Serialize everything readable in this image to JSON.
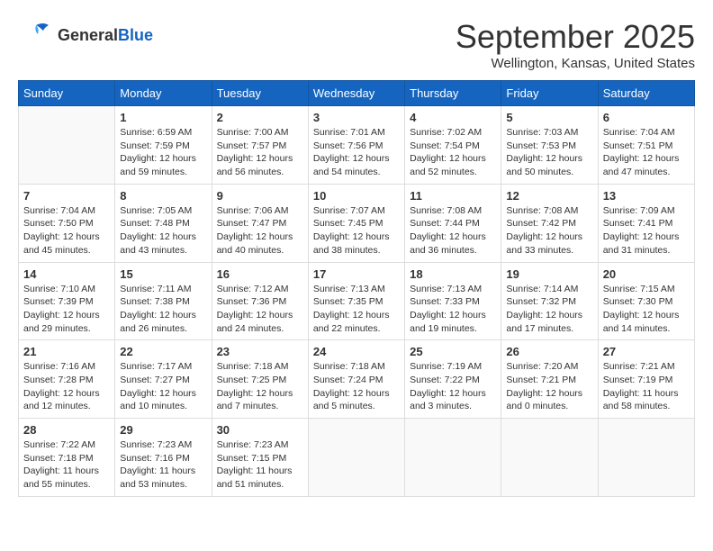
{
  "header": {
    "logo_general": "General",
    "logo_blue": "Blue",
    "month": "September 2025",
    "location": "Wellington, Kansas, United States"
  },
  "days_of_week": [
    "Sunday",
    "Monday",
    "Tuesday",
    "Wednesday",
    "Thursday",
    "Friday",
    "Saturday"
  ],
  "weeks": [
    [
      {
        "day": "",
        "info": ""
      },
      {
        "day": "1",
        "info": "Sunrise: 6:59 AM\nSunset: 7:59 PM\nDaylight: 12 hours\nand 59 minutes."
      },
      {
        "day": "2",
        "info": "Sunrise: 7:00 AM\nSunset: 7:57 PM\nDaylight: 12 hours\nand 56 minutes."
      },
      {
        "day": "3",
        "info": "Sunrise: 7:01 AM\nSunset: 7:56 PM\nDaylight: 12 hours\nand 54 minutes."
      },
      {
        "day": "4",
        "info": "Sunrise: 7:02 AM\nSunset: 7:54 PM\nDaylight: 12 hours\nand 52 minutes."
      },
      {
        "day": "5",
        "info": "Sunrise: 7:03 AM\nSunset: 7:53 PM\nDaylight: 12 hours\nand 50 minutes."
      },
      {
        "day": "6",
        "info": "Sunrise: 7:04 AM\nSunset: 7:51 PM\nDaylight: 12 hours\nand 47 minutes."
      }
    ],
    [
      {
        "day": "7",
        "info": "Sunrise: 7:04 AM\nSunset: 7:50 PM\nDaylight: 12 hours\nand 45 minutes."
      },
      {
        "day": "8",
        "info": "Sunrise: 7:05 AM\nSunset: 7:48 PM\nDaylight: 12 hours\nand 43 minutes."
      },
      {
        "day": "9",
        "info": "Sunrise: 7:06 AM\nSunset: 7:47 PM\nDaylight: 12 hours\nand 40 minutes."
      },
      {
        "day": "10",
        "info": "Sunrise: 7:07 AM\nSunset: 7:45 PM\nDaylight: 12 hours\nand 38 minutes."
      },
      {
        "day": "11",
        "info": "Sunrise: 7:08 AM\nSunset: 7:44 PM\nDaylight: 12 hours\nand 36 minutes."
      },
      {
        "day": "12",
        "info": "Sunrise: 7:08 AM\nSunset: 7:42 PM\nDaylight: 12 hours\nand 33 minutes."
      },
      {
        "day": "13",
        "info": "Sunrise: 7:09 AM\nSunset: 7:41 PM\nDaylight: 12 hours\nand 31 minutes."
      }
    ],
    [
      {
        "day": "14",
        "info": "Sunrise: 7:10 AM\nSunset: 7:39 PM\nDaylight: 12 hours\nand 29 minutes."
      },
      {
        "day": "15",
        "info": "Sunrise: 7:11 AM\nSunset: 7:38 PM\nDaylight: 12 hours\nand 26 minutes."
      },
      {
        "day": "16",
        "info": "Sunrise: 7:12 AM\nSunset: 7:36 PM\nDaylight: 12 hours\nand 24 minutes."
      },
      {
        "day": "17",
        "info": "Sunrise: 7:13 AM\nSunset: 7:35 PM\nDaylight: 12 hours\nand 22 minutes."
      },
      {
        "day": "18",
        "info": "Sunrise: 7:13 AM\nSunset: 7:33 PM\nDaylight: 12 hours\nand 19 minutes."
      },
      {
        "day": "19",
        "info": "Sunrise: 7:14 AM\nSunset: 7:32 PM\nDaylight: 12 hours\nand 17 minutes."
      },
      {
        "day": "20",
        "info": "Sunrise: 7:15 AM\nSunset: 7:30 PM\nDaylight: 12 hours\nand 14 minutes."
      }
    ],
    [
      {
        "day": "21",
        "info": "Sunrise: 7:16 AM\nSunset: 7:28 PM\nDaylight: 12 hours\nand 12 minutes."
      },
      {
        "day": "22",
        "info": "Sunrise: 7:17 AM\nSunset: 7:27 PM\nDaylight: 12 hours\nand 10 minutes."
      },
      {
        "day": "23",
        "info": "Sunrise: 7:18 AM\nSunset: 7:25 PM\nDaylight: 12 hours\nand 7 minutes."
      },
      {
        "day": "24",
        "info": "Sunrise: 7:18 AM\nSunset: 7:24 PM\nDaylight: 12 hours\nand 5 minutes."
      },
      {
        "day": "25",
        "info": "Sunrise: 7:19 AM\nSunset: 7:22 PM\nDaylight: 12 hours\nand 3 minutes."
      },
      {
        "day": "26",
        "info": "Sunrise: 7:20 AM\nSunset: 7:21 PM\nDaylight: 12 hours\nand 0 minutes."
      },
      {
        "day": "27",
        "info": "Sunrise: 7:21 AM\nSunset: 7:19 PM\nDaylight: 11 hours\nand 58 minutes."
      }
    ],
    [
      {
        "day": "28",
        "info": "Sunrise: 7:22 AM\nSunset: 7:18 PM\nDaylight: 11 hours\nand 55 minutes."
      },
      {
        "day": "29",
        "info": "Sunrise: 7:23 AM\nSunset: 7:16 PM\nDaylight: 11 hours\nand 53 minutes."
      },
      {
        "day": "30",
        "info": "Sunrise: 7:23 AM\nSunset: 7:15 PM\nDaylight: 11 hours\nand 51 minutes."
      },
      {
        "day": "",
        "info": ""
      },
      {
        "day": "",
        "info": ""
      },
      {
        "day": "",
        "info": ""
      },
      {
        "day": "",
        "info": ""
      }
    ]
  ]
}
